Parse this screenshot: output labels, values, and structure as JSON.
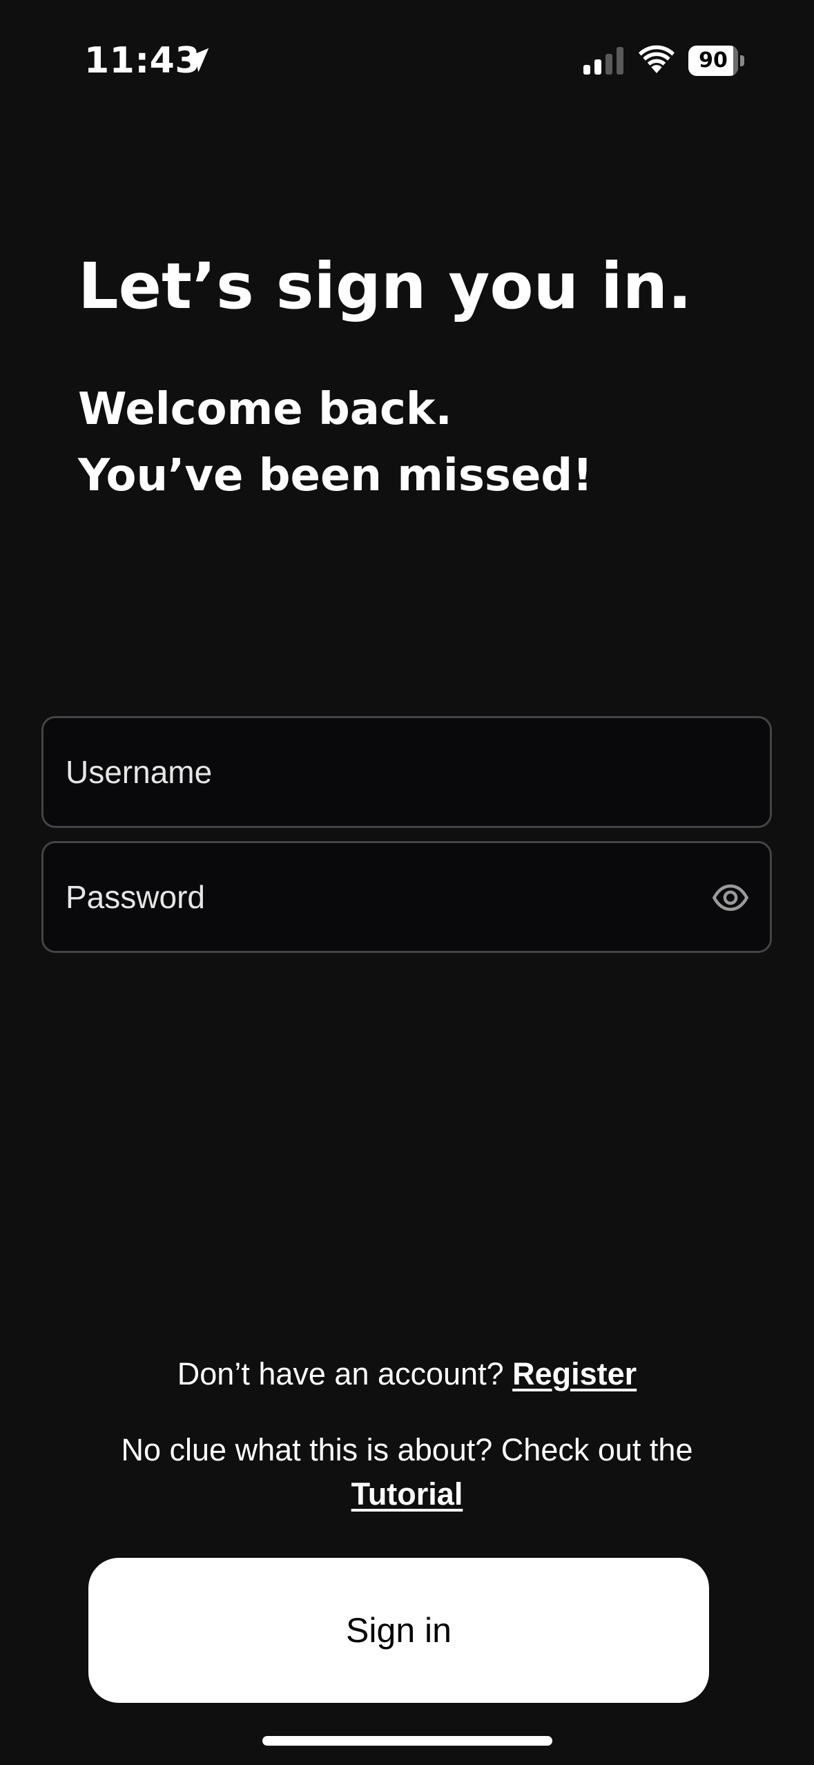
{
  "status_bar": {
    "time": "11:43",
    "battery_level": "90",
    "battery_fraction": 0.9,
    "icons": [
      "location-arrow-icon",
      "cellular-signal-icon",
      "wifi-icon",
      "battery-icon"
    ]
  },
  "header": {
    "title": "Let’s sign you in.",
    "subtitle_line1": "Welcome back.",
    "subtitle_line2": "You’ve been missed!"
  },
  "form": {
    "username_placeholder": "Username",
    "username_value": "",
    "password_placeholder": "Password",
    "password_value": "",
    "password_toggle_icon": "eye-icon"
  },
  "footer": {
    "register_prompt": "Don’t have an account? ",
    "register_link": "Register",
    "tutorial_prompt": "No clue what this is about? Check out the ",
    "tutorial_link": "Tutorial",
    "signin_label": "Sign in"
  },
  "colors": {
    "background": "#0f0f10",
    "field_background": "#09090b",
    "field_border": "#444447",
    "button_background": "#ffffff",
    "button_text": "#000000",
    "text": "#ffffff"
  }
}
